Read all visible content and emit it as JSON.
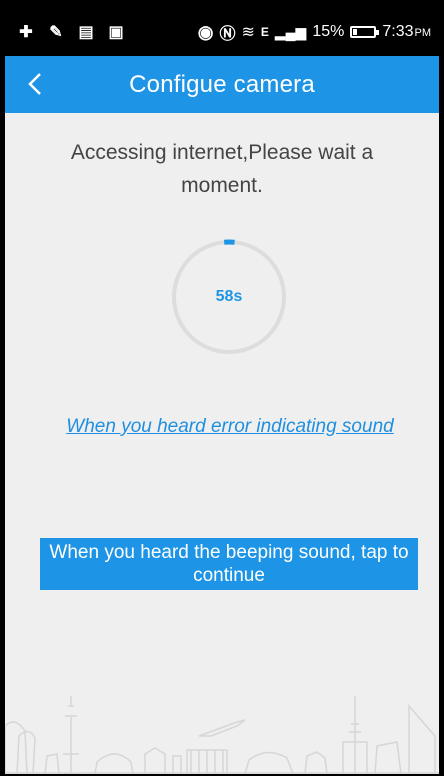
{
  "status_bar": {
    "battery": "15%",
    "time": "7:33",
    "ampm": "PM",
    "signal_label": "E",
    "icons": [
      "plus-icon",
      "edit-icon",
      "message-icon",
      "image-icon",
      "beats-icon",
      "nfc-icon",
      "wifi-icon",
      "signal-icon",
      "battery-icon"
    ]
  },
  "app_bar": {
    "title": "Configue camera",
    "back_icon": "chevron-left-icon"
  },
  "message": "Accessing internet,Please wait a moment.",
  "timer": {
    "text": "58s",
    "progress": 0.03
  },
  "error_link": "When you heard error indicating sound",
  "continue_button": "When you heard the beeping sound, tap to continue",
  "colors": {
    "accent": "#1e94e6",
    "background": "#efefef",
    "ring": "#dddddd"
  }
}
